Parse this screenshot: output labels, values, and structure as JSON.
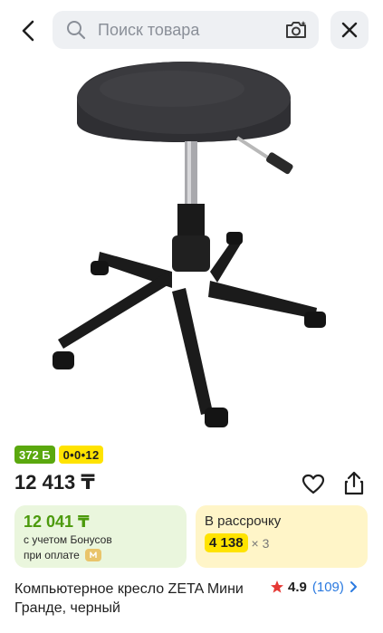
{
  "search": {
    "placeholder": "Поиск товара"
  },
  "icons": {
    "back": "chevron-left-icon",
    "search": "search-icon",
    "camera": "camera-icon",
    "close": "close-icon",
    "favorite": "heart-icon",
    "share": "share-icon",
    "star": "star-icon",
    "coin": "coin-icon",
    "chevron": "chevron-right-icon"
  },
  "badges": {
    "bonus": "372 Б",
    "installment": "0•0•12"
  },
  "price": {
    "current": "12 413 ₸"
  },
  "bonus_card": {
    "price": "12 041 ₸",
    "line1": "с учетом Бонусов",
    "line2": "при оплате"
  },
  "installment_card": {
    "title": "В рассрочку",
    "amount": "4 138",
    "times": "× 3"
  },
  "product": {
    "title": "Компьютерное кресло ZETA Мини Гранде, черный"
  },
  "rating": {
    "value": "4.9",
    "count": "(109)"
  },
  "colors": {
    "accent_green": "#5aa80e",
    "accent_yellow": "#ffe300",
    "link_blue": "#2b7ae0",
    "star_red": "#e53935"
  }
}
